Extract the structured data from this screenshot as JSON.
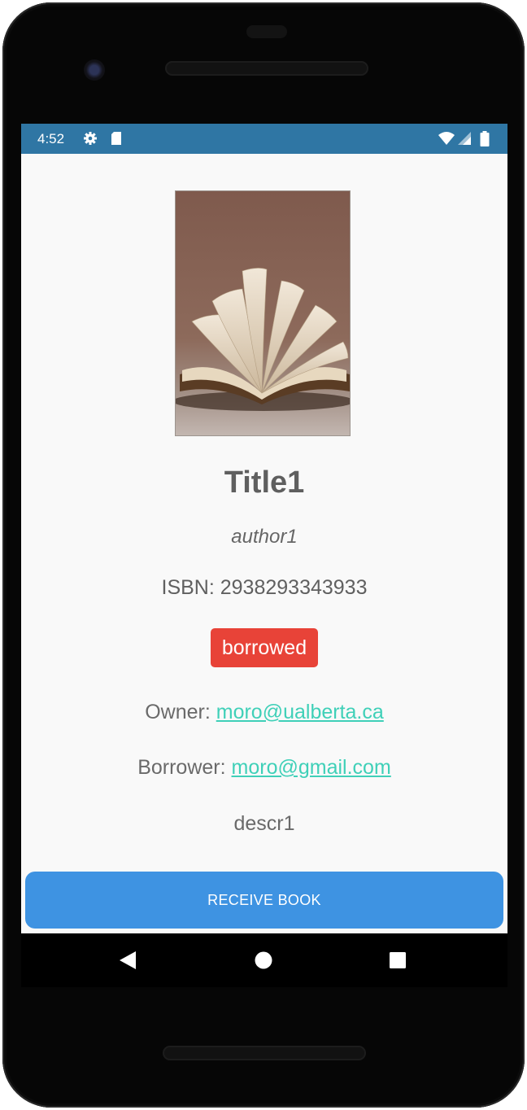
{
  "status_bar": {
    "time": "4:52",
    "left_icons": [
      "gear-icon",
      "sd-card-icon"
    ],
    "right_icons": [
      "wifi-icon",
      "signal-icon",
      "battery-icon"
    ],
    "color": "#2f76a4"
  },
  "book": {
    "cover_image": "open-book-photo",
    "title": "Title1",
    "author": "author1",
    "isbn": "ISBN: 2938293343933",
    "status": "borrowed",
    "owner_label": "Owner:",
    "owner_email": "moro@ualberta.ca",
    "borrower_label": "Borrower:",
    "borrower_email": "moro@gmail.com",
    "description": "descr1"
  },
  "actions": {
    "primary_label": "RECEIVE BOOK",
    "primary_color": "#3e93e2"
  },
  "colors": {
    "status_badge": "#e84338",
    "link": "#3fd0b8"
  },
  "nav_bar": {
    "icons": [
      "back-icon",
      "home-icon",
      "recents-icon"
    ]
  }
}
